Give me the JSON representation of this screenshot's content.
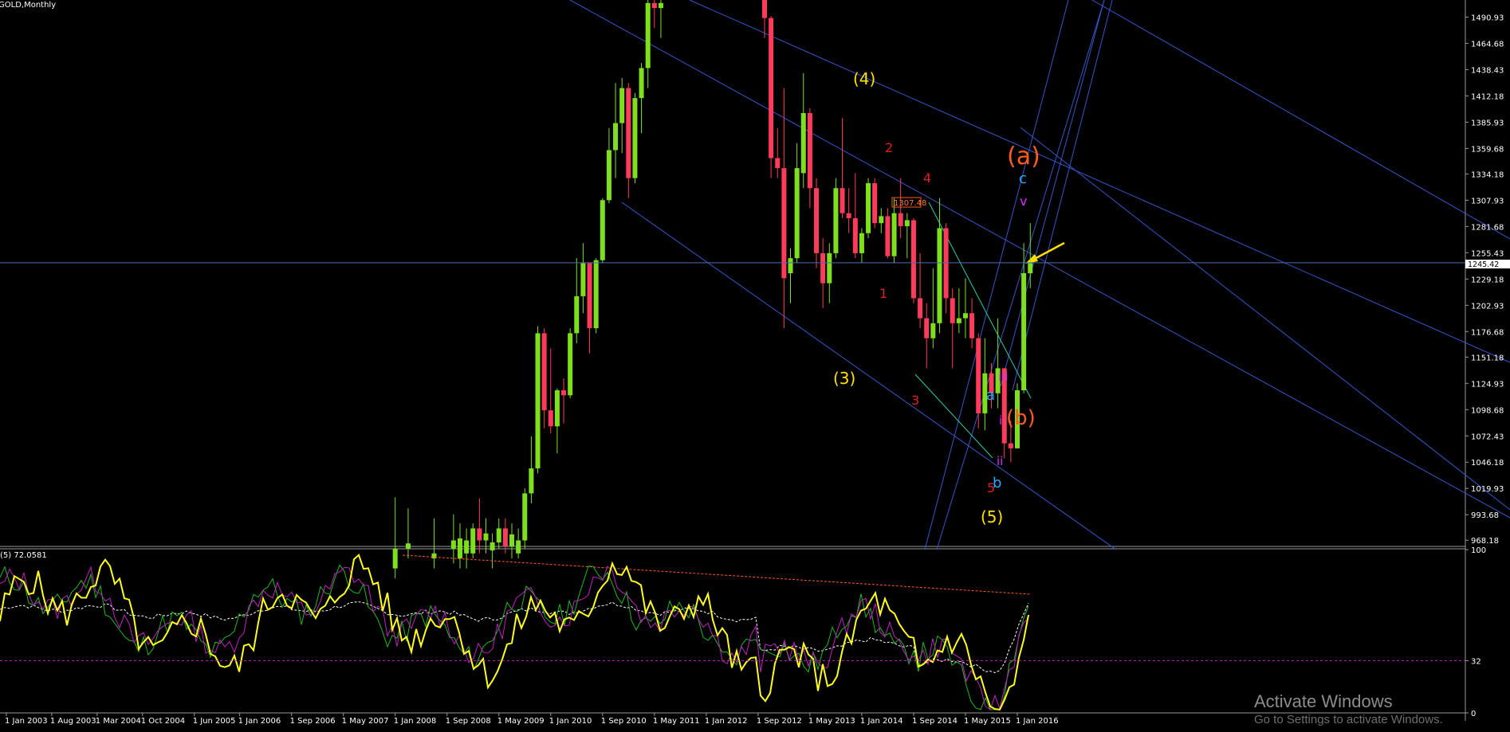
{
  "window": {
    "title": "GOLD,Monthly"
  },
  "chart_data": [
    {
      "type": "candlestick",
      "title": "GOLD,Monthly",
      "price_axis": {
        "ticks": [
          "1490.93",
          "1464.68",
          "1438.43",
          "1412.18",
          "1385.93",
          "1359.68",
          "1334.18",
          "1307.93",
          "1281.68",
          "1255.43",
          "1229.18",
          "1202.93",
          "1176.68",
          "1151.18",
          "1124.93",
          "1098.68",
          "1072.43",
          "1046.18",
          "1019.93",
          "993.68",
          "968.18"
        ],
        "ylim": [
          962,
          1508
        ]
      },
      "time_axis": {
        "ticks": [
          "1 Jan 2003",
          "1 Aug 2003",
          "1 Mar 2004",
          "1 Oct 2004",
          "1 Jun 2005",
          "1 Jan 2006",
          "1 Sep 2006",
          "1 May 2007",
          "1 Jan 2008",
          "1 Sep 2008",
          "1 May 2009",
          "1 Jan 2010",
          "1 Sep 2010",
          "1 May 2011",
          "1 Jan 2012",
          "1 Sep 2012",
          "1 May 2013",
          "1 Jan 2014",
          "1 Sep 2014",
          "1 May 2015",
          "1 Jan 2016"
        ],
        "xlim": [
          "2002-11",
          "2023-12"
        ]
      },
      "current_price": "1245.42",
      "colors": {
        "up": "#7ee01d",
        "down": "#ff3b5c",
        "price_line": "#4a6ea8",
        "channel": "#3556c8"
      },
      "candles": [
        {
          "t": "2008-01",
          "o": 940,
          "h": 1011,
          "l": 930,
          "c": 960
        },
        {
          "t": "2008-03",
          "o": 960,
          "h": 1000,
          "l": 950,
          "c": 965
        },
        {
          "t": "2008-07",
          "o": 950,
          "h": 990,
          "l": 940,
          "c": 955
        },
        {
          "t": "2008-10",
          "o": 960,
          "h": 994,
          "l": 945,
          "c": 968
        },
        {
          "t": "2008-11",
          "o": 950,
          "h": 985,
          "l": 940,
          "c": 970
        },
        {
          "t": "2008-12",
          "o": 955,
          "h": 980,
          "l": 940,
          "c": 968
        },
        {
          "t": "2009-01",
          "o": 955,
          "h": 985,
          "l": 950,
          "c": 980
        },
        {
          "t": "2009-02",
          "o": 980,
          "h": 1010,
          "l": 955,
          "c": 968
        },
        {
          "t": "2009-03",
          "o": 968,
          "h": 990,
          "l": 955,
          "c": 975
        },
        {
          "t": "2009-04",
          "o": 958,
          "h": 975,
          "l": 940,
          "c": 966
        },
        {
          "t": "2009-05",
          "o": 966,
          "h": 990,
          "l": 960,
          "c": 980
        },
        {
          "t": "2009-06",
          "o": 980,
          "h": 990,
          "l": 955,
          "c": 962
        },
        {
          "t": "2009-07",
          "o": 962,
          "h": 985,
          "l": 950,
          "c": 974
        },
        {
          "t": "2009-08",
          "o": 955,
          "h": 980,
          "l": 950,
          "c": 968
        },
        {
          "t": "2009-09",
          "o": 968,
          "h": 1020,
          "l": 960,
          "c": 1015
        },
        {
          "t": "2009-10",
          "o": 1015,
          "h": 1072,
          "l": 1005,
          "c": 1040
        },
        {
          "t": "2009-11",
          "o": 1040,
          "h": 1182,
          "l": 1035,
          "c": 1175
        },
        {
          "t": "2009-12",
          "o": 1175,
          "h": 1180,
          "l": 1080,
          "c": 1098
        },
        {
          "t": "2010-01",
          "o": 1098,
          "h": 1160,
          "l": 1075,
          "c": 1082
        },
        {
          "t": "2010-02",
          "o": 1082,
          "h": 1120,
          "l": 1055,
          "c": 1118
        },
        {
          "t": "2010-03",
          "o": 1118,
          "h": 1130,
          "l": 1085,
          "c": 1113
        },
        {
          "t": "2010-04",
          "o": 1113,
          "h": 1180,
          "l": 1110,
          "c": 1175
        },
        {
          "t": "2010-05",
          "o": 1175,
          "h": 1250,
          "l": 1165,
          "c": 1212
        },
        {
          "t": "2010-06",
          "o": 1212,
          "h": 1265,
          "l": 1195,
          "c": 1245
        },
        {
          "t": "2010-07",
          "o": 1245,
          "h": 1245,
          "l": 1155,
          "c": 1180
        },
        {
          "t": "2010-08",
          "o": 1180,
          "h": 1250,
          "l": 1175,
          "c": 1248
        },
        {
          "t": "2010-09",
          "o": 1248,
          "h": 1310,
          "l": 1245,
          "c": 1308
        },
        {
          "t": "2010-10",
          "o": 1308,
          "h": 1380,
          "l": 1305,
          "c": 1358
        },
        {
          "t": "2010-11",
          "o": 1358,
          "h": 1425,
          "l": 1330,
          "c": 1385
        },
        {
          "t": "2010-12",
          "o": 1385,
          "h": 1430,
          "l": 1355,
          "c": 1420
        },
        {
          "t": "2011-01",
          "o": 1420,
          "h": 1425,
          "l": 1310,
          "c": 1330
        },
        {
          "t": "2011-02",
          "o": 1330,
          "h": 1415,
          "l": 1325,
          "c": 1410
        },
        {
          "t": "2011-03",
          "o": 1410,
          "h": 1445,
          "l": 1375,
          "c": 1440
        },
        {
          "t": "2011-04",
          "o": 1440,
          "h": 1508,
          "l": 1420,
          "c": 1505
        },
        {
          "t": "2011-05",
          "o": 1505,
          "h": 1508,
          "l": 1480,
          "c": 1500
        },
        {
          "t": "2011-06",
          "o": 1500,
          "h": 1508,
          "l": 1470,
          "c": 1505
        },
        {
          "t": "2012-10",
          "o": 1508,
          "h": 1508,
          "l": 1470,
          "c": 1490
        },
        {
          "t": "2012-11",
          "o": 1490,
          "h": 1492,
          "l": 1330,
          "c": 1350
        },
        {
          "t": "2012-12",
          "o": 1350,
          "h": 1380,
          "l": 1330,
          "c": 1340
        },
        {
          "t": "2013-01",
          "o": 1340,
          "h": 1420,
          "l": 1180,
          "c": 1230
        },
        {
          "t": "2013-02",
          "o": 1235,
          "h": 1260,
          "l": 1205,
          "c": 1250
        },
        {
          "t": "2013-03",
          "o": 1250,
          "h": 1365,
          "l": 1245,
          "c": 1340
        },
        {
          "t": "2013-04",
          "o": 1335,
          "h": 1435,
          "l": 1320,
          "c": 1395
        },
        {
          "t": "2013-05",
          "o": 1395,
          "h": 1400,
          "l": 1300,
          "c": 1320
        },
        {
          "t": "2013-06",
          "o": 1320,
          "h": 1330,
          "l": 1240,
          "c": 1255
        },
        {
          "t": "2013-07",
          "o": 1255,
          "h": 1270,
          "l": 1200,
          "c": 1225
        },
        {
          "t": "2013-08",
          "o": 1225,
          "h": 1265,
          "l": 1205,
          "c": 1255
        },
        {
          "t": "2013-09",
          "o": 1255,
          "h": 1330,
          "l": 1250,
          "c": 1320
        },
        {
          "t": "2013-10",
          "o": 1320,
          "h": 1390,
          "l": 1290,
          "c": 1295
        },
        {
          "t": "2013-11",
          "o": 1295,
          "h": 1320,
          "l": 1275,
          "c": 1290
        },
        {
          "t": "2013-12",
          "o": 1290,
          "h": 1335,
          "l": 1250,
          "c": 1255
        },
        {
          "t": "2014-01",
          "o": 1255,
          "h": 1280,
          "l": 1245,
          "c": 1275
        },
        {
          "t": "2014-02",
          "o": 1275,
          "h": 1330,
          "l": 1270,
          "c": 1325
        },
        {
          "t": "2014-03",
          "o": 1325,
          "h": 1330,
          "l": 1280,
          "c": 1285
        },
        {
          "t": "2014-04",
          "o": 1285,
          "h": 1300,
          "l": 1275,
          "c": 1292
        },
        {
          "t": "2014-05",
          "o": 1292,
          "h": 1300,
          "l": 1250,
          "c": 1252
        },
        {
          "t": "2014-06",
          "o": 1252,
          "h": 1310,
          "l": 1245,
          "c": 1295
        },
        {
          "t": "2014-07",
          "o": 1295,
          "h": 1330,
          "l": 1270,
          "c": 1282
        },
        {
          "t": "2014-08",
          "o": 1282,
          "h": 1295,
          "l": 1250,
          "c": 1288
        },
        {
          "t": "2014-09",
          "o": 1288,
          "h": 1290,
          "l": 1205,
          "c": 1210
        },
        {
          "t": "2014-10",
          "o": 1210,
          "h": 1255,
          "l": 1180,
          "c": 1190
        },
        {
          "t": "2014-11",
          "o": 1190,
          "h": 1205,
          "l": 1140,
          "c": 1170
        },
        {
          "t": "2014-12",
          "o": 1170,
          "h": 1240,
          "l": 1160,
          "c": 1185
        },
        {
          "t": "2015-01",
          "o": 1185,
          "h": 1310,
          "l": 1175,
          "c": 1280
        },
        {
          "t": "2015-02",
          "o": 1280,
          "h": 1285,
          "l": 1195,
          "c": 1210
        },
        {
          "t": "2015-03",
          "o": 1210,
          "h": 1220,
          "l": 1140,
          "c": 1185
        },
        {
          "t": "2015-04",
          "o": 1185,
          "h": 1220,
          "l": 1175,
          "c": 1190
        },
        {
          "t": "2015-05",
          "o": 1190,
          "h": 1230,
          "l": 1170,
          "c": 1195
        },
        {
          "t": "2015-06",
          "o": 1195,
          "h": 1210,
          "l": 1160,
          "c": 1170
        },
        {
          "t": "2015-07",
          "o": 1170,
          "h": 1175,
          "l": 1080,
          "c": 1095
        },
        {
          "t": "2015-08",
          "o": 1095,
          "h": 1170,
          "l": 1078,
          "c": 1135
        },
        {
          "t": "2015-09",
          "o": 1135,
          "h": 1145,
          "l": 1100,
          "c": 1115
        },
        {
          "t": "2015-10",
          "o": 1115,
          "h": 1190,
          "l": 1100,
          "c": 1140
        },
        {
          "t": "2015-11",
          "o": 1140,
          "h": 1140,
          "l": 1050,
          "c": 1065
        },
        {
          "t": "2015-12",
          "o": 1065,
          "h": 1088,
          "l": 1046,
          "c": 1060
        },
        {
          "t": "2016-01",
          "o": 1060,
          "h": 1125,
          "l": 1060,
          "c": 1118
        },
        {
          "t": "2016-02",
          "o": 1118,
          "h": 1265,
          "l": 1115,
          "c": 1235
        },
        {
          "t": "2016-03",
          "o": 1235,
          "h": 1285,
          "l": 1220,
          "c": 1245
        }
      ],
      "annotations": [
        {
          "text": "(4)",
          "color": "#ffe000"
        },
        {
          "text": "(3)",
          "color": "#ffe000"
        },
        {
          "text": "(5)",
          "color": "#ffe000"
        },
        {
          "text": "(a)",
          "color": "#ff5a1f"
        },
        {
          "text": "(b)",
          "color": "#ff5a1f"
        },
        {
          "text": "1",
          "color": "#e02020"
        },
        {
          "text": "2",
          "color": "#e02020"
        },
        {
          "text": "3",
          "color": "#e02020"
        },
        {
          "text": "4",
          "color": "#e02020"
        },
        {
          "text": "5",
          "color": "#e02020"
        },
        {
          "text": "c",
          "color": "#29a8ff"
        },
        {
          "text": "b",
          "color": "#29a8ff"
        },
        {
          "text": "a",
          "color": "#29a8ff"
        },
        {
          "text": "v",
          "color": "#d030ff"
        },
        {
          "text": "iii",
          "color": "#d030ff"
        },
        {
          "text": "ii",
          "color": "#d030ff"
        },
        {
          "text": "i",
          "color": "#d030ff"
        }
      ],
      "price_box": "1307.48"
    },
    {
      "type": "line",
      "title": "(5) 72.0581",
      "yticks": [
        "100",
        "32",
        "0"
      ],
      "ylim": [
        0,
        100
      ],
      "levels": [
        32
      ],
      "colors": {
        "main": "#ffff1e",
        "signal1": "#1db91d",
        "signal2": "#c020c0",
        "average": "#ffffff",
        "trend": "#ff5a1f",
        "level": "#c020c0"
      }
    }
  ],
  "watermark": {
    "line1": "Activate Windows",
    "line2": "Go to Settings to activate Windows."
  }
}
